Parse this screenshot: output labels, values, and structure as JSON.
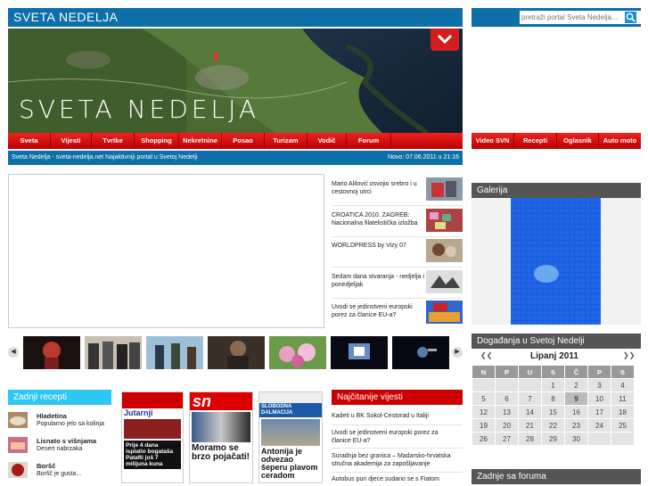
{
  "header": {
    "title": "SVETA NEDELJA",
    "hero_title": "SVETA NEDELJA"
  },
  "search": {
    "placeholder": "pretraži portal Sveta Nedelja..."
  },
  "nav": {
    "items": [
      "Sveta Nedelja",
      "Vijesti",
      "Tvrtke",
      "Shopping",
      "Nekretnine",
      "Posao",
      "Turizam",
      "Vodič",
      "Forum"
    ]
  },
  "nav2": {
    "items": [
      "Video SVN",
      "Recepti",
      "Oglasnik",
      "Auto moto"
    ]
  },
  "info": {
    "tagline": "Sveta Nedelja - sveta-nedelja.net Najaktivniji portal u Svetoj Nedelji",
    "datetime": "Novo: 07.06.2011  u  21:16"
  },
  "news": [
    {
      "text": "Mario Alilović osvojio srebro i u cestovnoj utrci"
    },
    {
      "text": "CROATICA 2010. ZAGREB: Nacionalna filatelistička izložba"
    },
    {
      "text": "WORLDPRESS by Vizy 07"
    },
    {
      "text": "Sedam dana stvaranja - nedjelja i ponedjeljak"
    },
    {
      "text": "Uvodi se jedinstveni europski porez za članice EU-a?"
    }
  ],
  "galerija": {
    "title": "Galerija"
  },
  "dogadanja": {
    "title": "Događanja u Svetoj Nedelji",
    "month": "Lipanj 2011",
    "prev": "❮❮",
    "next": "❯❯",
    "days": [
      "N",
      "P",
      "U",
      "S",
      "Č",
      "P",
      "S"
    ],
    "weeks": [
      [
        "",
        "",
        "",
        "1",
        "2",
        "3",
        "4"
      ],
      [
        "5",
        "6",
        "7",
        "8",
        "9",
        "10",
        "11"
      ],
      [
        "12",
        "13",
        "14",
        "15",
        "16",
        "17",
        "18"
      ],
      [
        "19",
        "20",
        "21",
        "22",
        "23",
        "24",
        "25"
      ],
      [
        "26",
        "27",
        "28",
        "29",
        "30",
        "",
        ""
      ]
    ]
  },
  "recepti": {
    "title": "Zadnji recepti",
    "items": [
      {
        "name": "Hladetina",
        "desc": "Popularno jelo sa kolinja"
      },
      {
        "name": "Lisnato s višnjama",
        "desc": "Desert nabrzaka"
      },
      {
        "name": "Boršč",
        "desc": "Boršč je gusta..."
      }
    ]
  },
  "najcitanije": {
    "title": "Najčitanije vijesti",
    "items": [
      "Kadeti u BK Sokol-Cestorad u Italiji",
      "Uvodi se jedinstveni europski porez za članice EU-a?",
      "Suradnja bez granica – Madarsko-hrvatska stručna akademija za zapošljavanje",
      "Autobus pun djece sudario se s Fiatom"
    ]
  },
  "forum": {
    "title": "Zadnje sa foruma"
  },
  "papers": {
    "p1": {
      "masthead": "Jutarnji",
      "headline": "Prije 4 dana isplatio bogataša Patafti još 7 milijuna kuna"
    },
    "p2": {
      "masthead": "sn",
      "headline": "Moramo se brzo pojačati!"
    },
    "p3": {
      "masthead": "SLOBODNA DALMACIJA",
      "headline": "Antonija je odvezao šeperu plavom ceradom"
    }
  },
  "colors": {
    "blue": "#0d6fa8",
    "red": "#cc0000",
    "cyan": "#2ec7f2",
    "dark": "#555555"
  }
}
